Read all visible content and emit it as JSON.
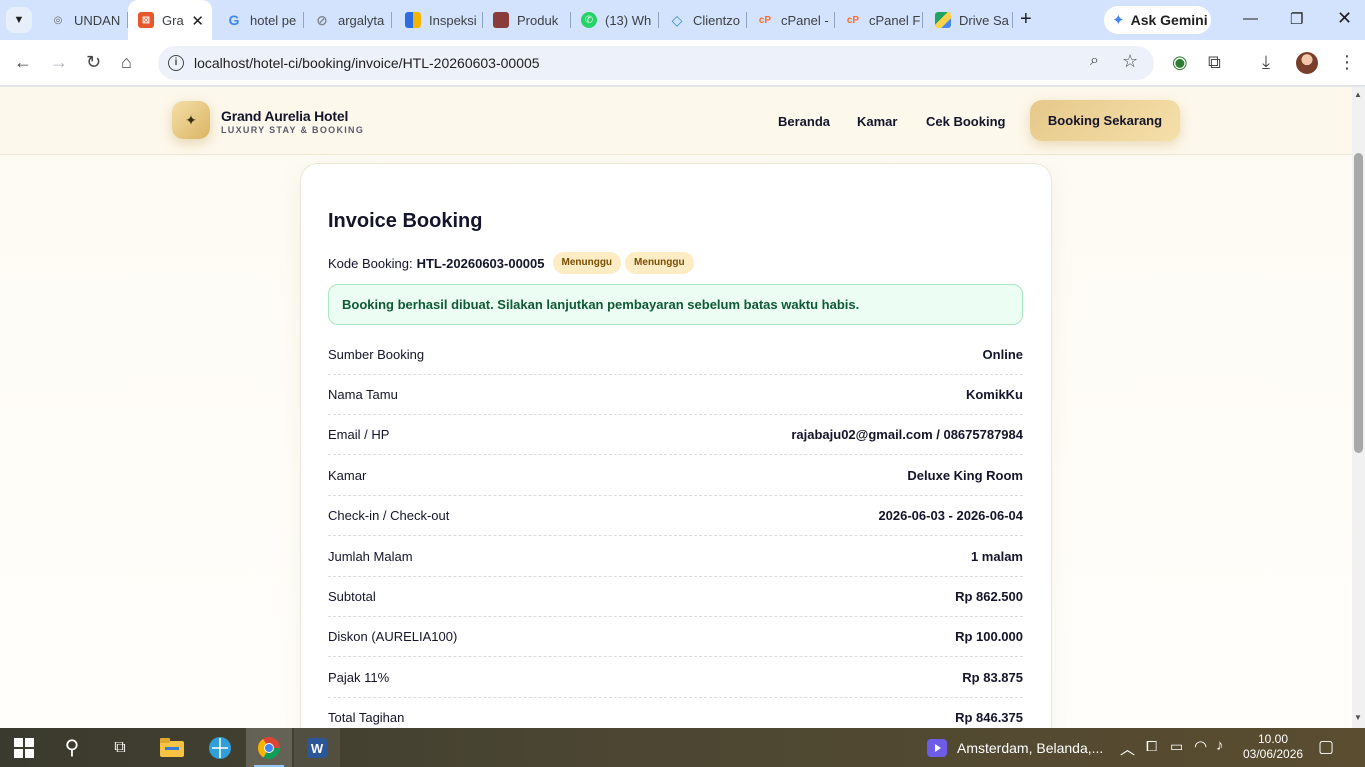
{
  "browser": {
    "tabs": [
      {
        "label": "UNDAN",
        "fav_color": "#5f6368",
        "fav_glyph": "◎"
      },
      {
        "label": "Gra",
        "fav_color": "#e8572a",
        "fav_glyph": "⊠",
        "active": true
      },
      {
        "label": "hotel pe",
        "fav_color": "#ffffff",
        "fav_glyph": "G"
      },
      {
        "label": "argalyta",
        "fav_color": "#80868b",
        "fav_glyph": "⊘"
      },
      {
        "label": "Inspeksi",
        "fav_color": "#2d6cdf",
        "fav_glyph": "▮"
      },
      {
        "label": "Produk",
        "fav_color": "#8a3b3b",
        "fav_glyph": "▬"
      },
      {
        "label": "(13) Wh",
        "fav_color": "#25d366",
        "fav_glyph": "✆"
      },
      {
        "label": "Clientzo",
        "fav_color": "#2f8fd8",
        "fav_glyph": "◇"
      },
      {
        "label": "cPanel -",
        "fav_color": "#ff6c2c",
        "fav_glyph": "cP"
      },
      {
        "label": "cPanel F",
        "fav_color": "#ff6c2c",
        "fav_glyph": "cP"
      },
      {
        "label": "Drive Sa",
        "fav_color": "#1fa463",
        "fav_glyph": "▲"
      }
    ],
    "ask_gemini": "Ask Gemini",
    "url": "localhost/hotel-ci/booking/invoice/HTL-20260603-00005"
  },
  "site": {
    "brand_name": "Grand Aurelia Hotel",
    "brand_tagline": "LUXURY STAY & BOOKING",
    "nav": {
      "home": "Beranda",
      "rooms": "Kamar",
      "check_booking": "Cek Booking",
      "cta": "Booking Sekarang"
    }
  },
  "invoice": {
    "title": "Invoice Booking",
    "code_label": "Kode Booking:",
    "code_value": "HTL-20260603-00005",
    "badge_1": "Menunggu",
    "badge_2": "Menunggu",
    "alert": "Booking berhasil dibuat. Silakan lanjutkan pembayaran sebelum batas waktu habis.",
    "rows": [
      {
        "label": "Sumber Booking",
        "value": "Online"
      },
      {
        "label": "Nama Tamu",
        "value": "KomikKu"
      },
      {
        "label": "Email / HP",
        "value": "rajabaju02@gmail.com / 08675787984"
      },
      {
        "label": "Kamar",
        "value": "Deluxe King Room"
      },
      {
        "label": "Check-in / Check-out",
        "value": "2026-06-03 - 2026-06-04"
      },
      {
        "label": "Jumlah Malam",
        "value": "1 malam"
      },
      {
        "label": "Subtotal",
        "value": "Rp 862.500"
      },
      {
        "label": "Diskon (AURELIA100)",
        "value": "Rp 100.000"
      },
      {
        "label": "Pajak 11%",
        "value": "Rp 83.875"
      },
      {
        "label": "Total Tagihan",
        "value": "Rp 846.375"
      }
    ]
  },
  "taskbar": {
    "weather": "Amsterdam, Belanda,...",
    "time": "10.00",
    "date": "03/06/2026"
  },
  "colors": {
    "accent_gold": "#e6c98a",
    "success_bg": "#ecfdf3",
    "success_text": "#0d5a34",
    "badge_bg": "#fdecc4"
  }
}
